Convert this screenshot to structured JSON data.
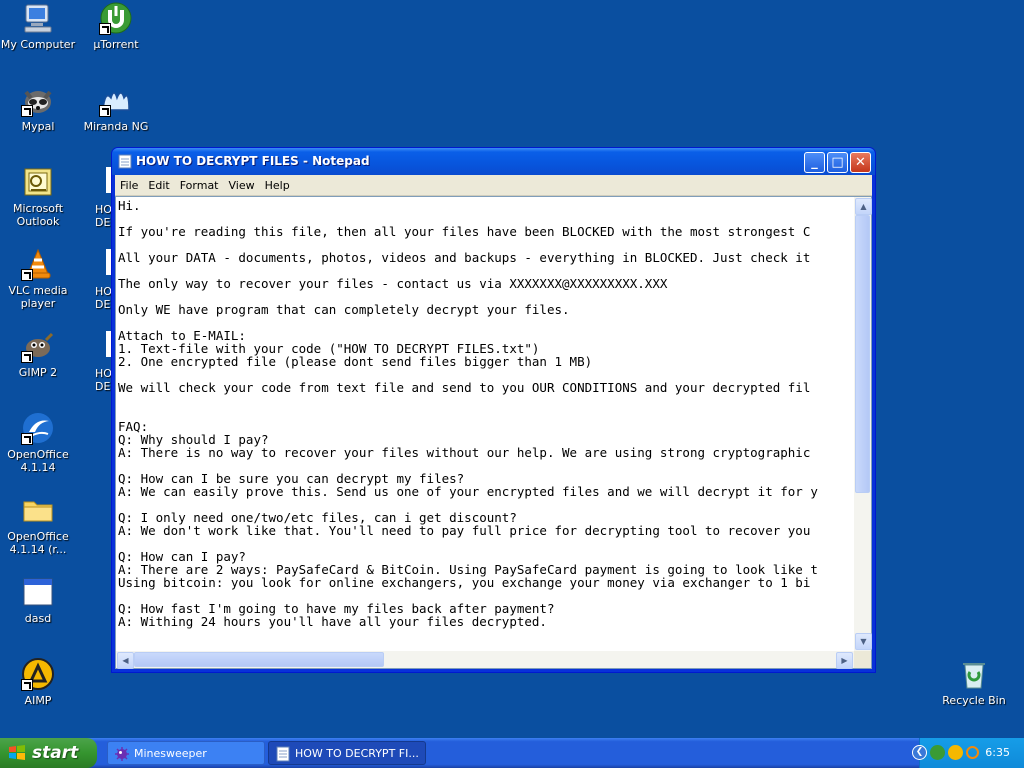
{
  "desktop": {
    "icons": [
      {
        "label": "My Computer",
        "icon": "my-computer-icon"
      },
      {
        "label": "µTorrent",
        "icon": "utorrent-icon"
      },
      {
        "label": "Mypal",
        "icon": "mypal-icon"
      },
      {
        "label": "Miranda NG",
        "icon": "miranda-icon"
      },
      {
        "label": "Microsoft Outlook",
        "icon": "outlook-icon"
      },
      {
        "label": "VLC media player",
        "icon": "vlc-icon"
      },
      {
        "label": "GIMP 2",
        "icon": "gimp-icon"
      },
      {
        "label": "OpenOffice 4.1.14",
        "icon": "openoffice-icon"
      },
      {
        "label": "OpenOffice 4.1.14 (r...",
        "icon": "folder-icon"
      },
      {
        "label": "dasd",
        "icon": "window-icon"
      },
      {
        "label": "AIMP",
        "icon": "aimp-icon"
      },
      {
        "label": "Recycle Bin",
        "icon": "recycle-bin-icon"
      }
    ],
    "partial_labels": [
      "HO\nDE",
      "HO\nDE",
      "HO\nDE"
    ]
  },
  "window": {
    "title": "HOW TO DECRYPT FILES - Notepad",
    "minimize": "_",
    "maximize": "□",
    "close": "✕",
    "menu": [
      "File",
      "Edit",
      "Format",
      "View",
      "Help"
    ],
    "lines": [
      "Hi.",
      "",
      "If you're reading this file, then all your files have been BLOCKED with the most strongest C",
      "",
      "All your DATA - documents, photos, videos and backups - everything in BLOCKED. Just check it",
      "",
      "The only way to recover your files - contact us via XXXXXXX@XXXXXXXXX.XXX",
      "",
      "Only WE have program that can completely decrypt your files.",
      "",
      "Attach to E-MAIL:",
      "1. Text-file with your code (\"HOW TO DECRYPT FILES.txt\")",
      "2. One encrypted file (please dont send files bigger than 1 MB)",
      "",
      "We will check your code from text file and send to you OUR CONDITIONS and your decrypted fil",
      "",
      "",
      "FAQ:",
      "Q: Why should I pay?",
      "A: There is no way to recover your files without our help. We are using strong cryptographic",
      "",
      "Q: How can I be sure you can decrypt my files?",
      "A: We can easily prove this. Send us one of your encrypted files and we will decrypt it for y",
      "",
      "Q: I only need one/two/etc files, can i get discount?",
      "A: We don't work like that. You'll need to pay full price for decrypting tool to recover you",
      "",
      "Q: How can I pay?",
      "A: There are 2 ways: PaySafeCard & BitCoin. Using PaySafeCard payment is going to look like t",
      "Using bitcoin: you look for online exchangers, you exchange your money via exchanger to 1 bi",
      "",
      "Q: How fast I'm going to have my files back after payment?",
      "A: Withing 24 hours you'll have all your files decrypted."
    ]
  },
  "taskbar": {
    "start_label": "start",
    "tasks": [
      {
        "label": "Minesweeper",
        "icon": "minesweeper-icon"
      },
      {
        "label": "HOW TO DECRYPT FI...",
        "icon": "notepad-icon"
      }
    ],
    "clock": "6:35"
  },
  "colors": {
    "desktop": "#0a4fa0",
    "title_bar": "#0855dd",
    "start_green": "#35952f",
    "tray": "#0f8ad9"
  }
}
